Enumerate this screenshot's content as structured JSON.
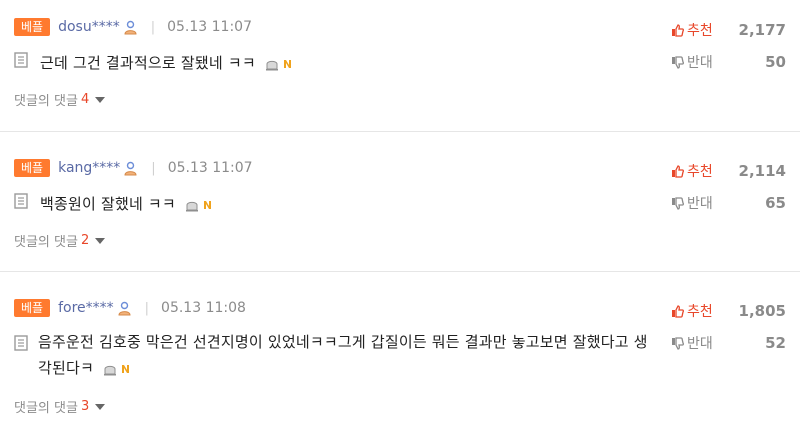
{
  "comments": [
    {
      "badge": "베플",
      "user": "dosu****",
      "date": "05.13 11:07",
      "text": "근데 그건 결과적으로 잘됐네 ㅋㅋ",
      "reply_label": "댓글의 댓글",
      "reply_count": "4",
      "up_label": "추천",
      "up_count": "2,177",
      "down_label": "반대",
      "down_count": "50"
    },
    {
      "badge": "베플",
      "user": "kang****",
      "date": "05.13 11:07",
      "text": "백종원이 잘했네 ㅋㅋ",
      "reply_label": "댓글의 댓글",
      "reply_count": "2",
      "up_label": "추천",
      "up_count": "2,114",
      "down_label": "반대",
      "down_count": "65"
    },
    {
      "badge": "베플",
      "user": "fore****",
      "date": "05.13 11:08",
      "text": "음주운전 김호중 막은건 선견지명이 있었네ㅋㅋ그게 갑질이든 뭐든 결과만 놓고보면 잘했다고 생각된다ㅋ",
      "reply_label": "댓글의 댓글",
      "reply_count": "3",
      "up_label": "추천",
      "up_count": "1,805",
      "down_label": "반대",
      "down_count": "52"
    }
  ],
  "colors": {
    "badge": "#ff7a2f",
    "user": "#5a6aa5",
    "up": "#e8472a",
    "reply_count": "#e8472a"
  },
  "icons": [
    "user-profile-icon",
    "memo-icon",
    "report-icon",
    "n-badge-icon",
    "thumbs-up-icon",
    "thumbs-down-icon",
    "caret-down-icon"
  ]
}
